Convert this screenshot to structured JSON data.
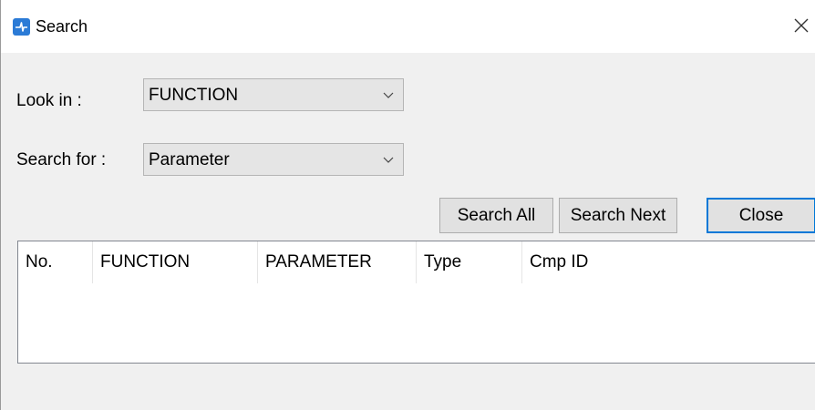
{
  "window": {
    "title": "Search",
    "icon": "app-logo-icon",
    "close_icon": "close-icon"
  },
  "form": {
    "look_in_label": "Look in :",
    "look_in_value": "FUNCTION",
    "search_for_label": "Search for :",
    "search_for_value": "Parameter"
  },
  "buttons": {
    "search_all": "Search All",
    "search_next": "Search Next",
    "close": "Close"
  },
  "table": {
    "columns": [
      "No.",
      "FUNCTION",
      "PARAMETER",
      "Type",
      "Cmp ID"
    ],
    "rows": []
  },
  "colors": {
    "accent": "#0078d7",
    "app_icon": "#2b7bd6"
  }
}
